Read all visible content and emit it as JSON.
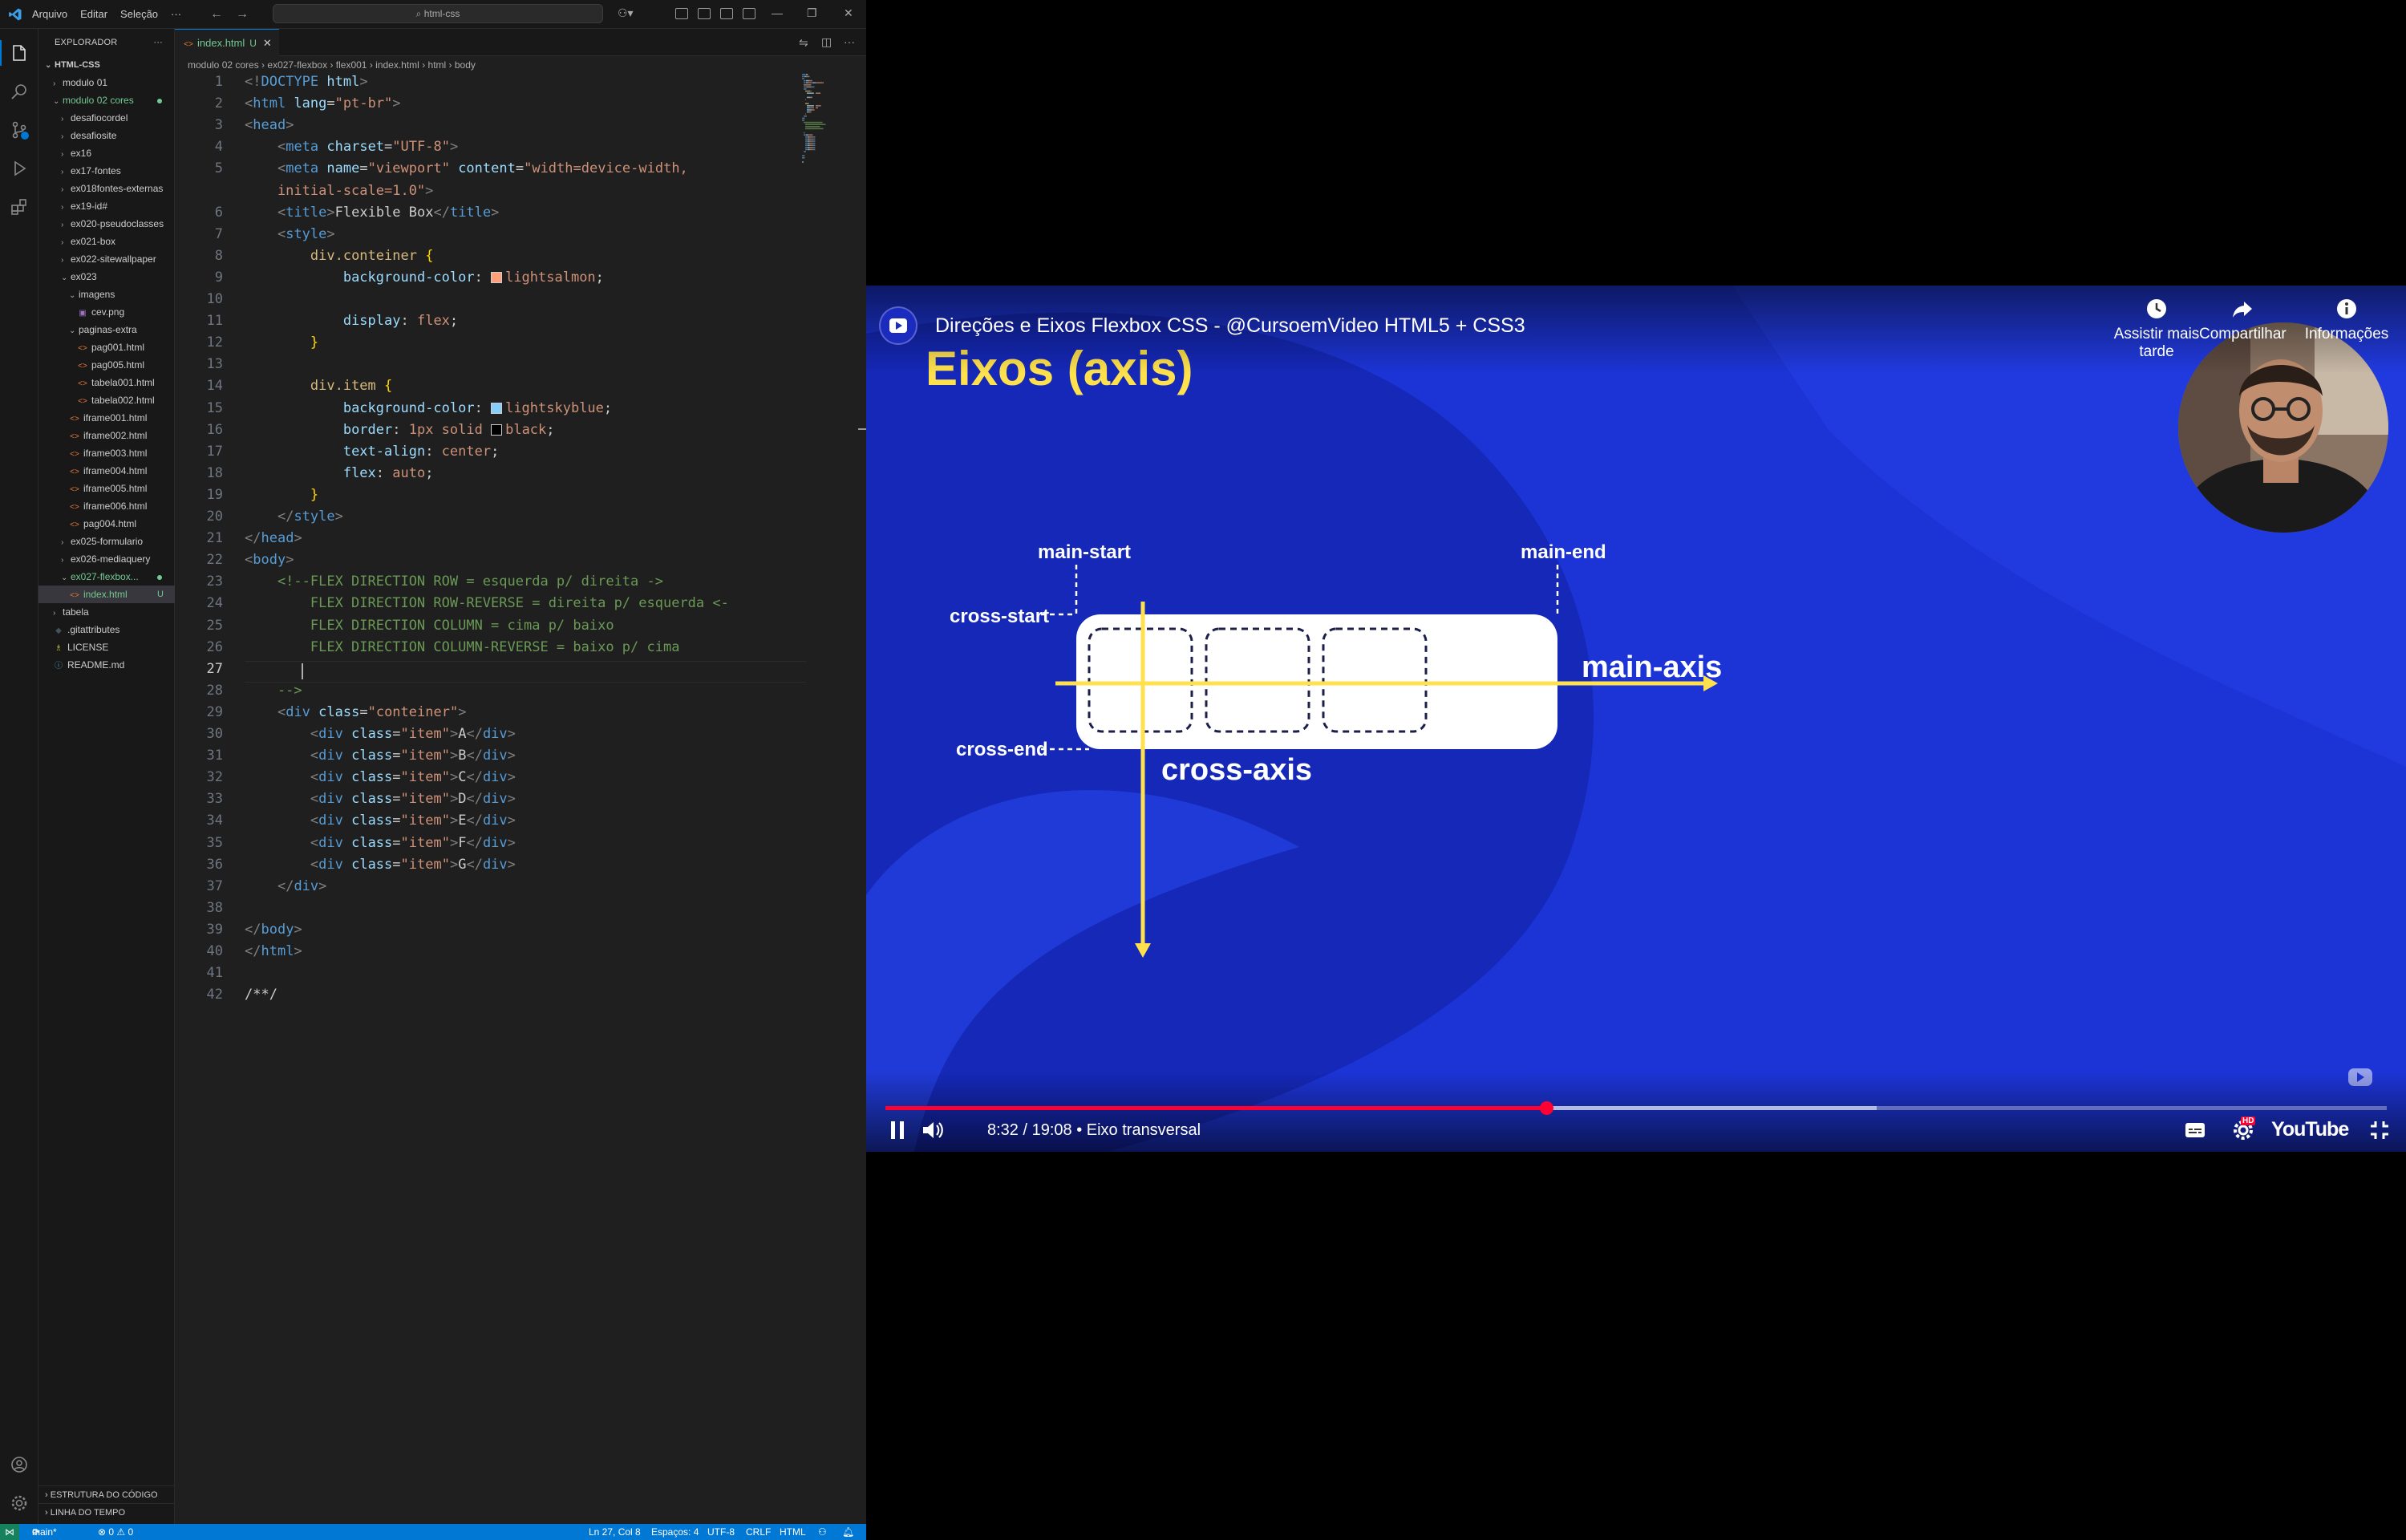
{
  "vscode": {
    "menu": [
      "Arquivo",
      "Editar",
      "Seleção",
      "···"
    ],
    "search_label": "html-css",
    "sidebar_title": "EXPLORADOR",
    "root": "HTML-CSS",
    "tree": [
      {
        "label": "modulo 01",
        "indent": 1,
        "type": "folder",
        "open": false
      },
      {
        "label": "modulo 02 cores",
        "indent": 1,
        "type": "folder",
        "open": true,
        "green": true,
        "dot": true
      },
      {
        "label": "desafiocordel",
        "indent": 2,
        "type": "folder",
        "open": false
      },
      {
        "label": "desafiosite",
        "indent": 2,
        "type": "folder",
        "open": false
      },
      {
        "label": "ex16",
        "indent": 2,
        "type": "folder",
        "open": false
      },
      {
        "label": "ex17-fontes",
        "indent": 2,
        "type": "folder",
        "open": false
      },
      {
        "label": "ex018fontes-externas",
        "indent": 2,
        "type": "folder",
        "open": false
      },
      {
        "label": "ex19-id#",
        "indent": 2,
        "type": "folder",
        "open": false
      },
      {
        "label": "ex020-pseudoclasses",
        "indent": 2,
        "type": "folder",
        "open": false
      },
      {
        "label": "ex021-box",
        "indent": 2,
        "type": "folder",
        "open": false
      },
      {
        "label": "ex022-sitewallpaper",
        "indent": 2,
        "type": "folder",
        "open": false
      },
      {
        "label": "ex023",
        "indent": 2,
        "type": "folder",
        "open": true
      },
      {
        "label": "imagens",
        "indent": 3,
        "type": "folder",
        "open": true
      },
      {
        "label": "cev.png",
        "indent": 4,
        "type": "img"
      },
      {
        "label": "paginas-extra",
        "indent": 3,
        "type": "folder",
        "open": true
      },
      {
        "label": "pag001.html",
        "indent": 4,
        "type": "html"
      },
      {
        "label": "pag005.html",
        "indent": 4,
        "type": "html"
      },
      {
        "label": "tabela001.html",
        "indent": 4,
        "type": "html"
      },
      {
        "label": "tabela002.html",
        "indent": 4,
        "type": "html"
      },
      {
        "label": "iframe001.html",
        "indent": 3,
        "type": "html"
      },
      {
        "label": "iframe002.html",
        "indent": 3,
        "type": "html"
      },
      {
        "label": "iframe003.html",
        "indent": 3,
        "type": "html"
      },
      {
        "label": "iframe004.html",
        "indent": 3,
        "type": "html"
      },
      {
        "label": "iframe005.html",
        "indent": 3,
        "type": "html"
      },
      {
        "label": "iframe006.html",
        "indent": 3,
        "type": "html"
      },
      {
        "label": "pag004.html",
        "indent": 3,
        "type": "html"
      },
      {
        "label": "ex025-formulario",
        "indent": 2,
        "type": "folder",
        "open": false
      },
      {
        "label": "ex026-mediaquery",
        "indent": 2,
        "type": "folder",
        "open": false
      },
      {
        "label": "ex027-flexbox...",
        "indent": 2,
        "type": "folder",
        "open": true,
        "green": true,
        "dot": true,
        "sel": true
      },
      {
        "label": "index.html",
        "indent": 3,
        "type": "html",
        "green": true,
        "badge": "U",
        "sel2": true
      },
      {
        "label": "tabela",
        "indent": 1,
        "type": "folder",
        "open": false
      },
      {
        "label": ".gitattributes",
        "indent": 1,
        "type": "git"
      },
      {
        "label": "LICENSE",
        "indent": 1,
        "type": "lic"
      },
      {
        "label": "README.md",
        "indent": 1,
        "type": "info"
      }
    ],
    "outline": "ESTRUTURA DO CÓDIGO",
    "timeline": "LINHA DO TEMPO",
    "tab_label": "index.html",
    "tab_badge": "U",
    "breadcrumb": [
      "modulo 02 cores",
      "ex027-flexbox",
      "flex001",
      "index.html",
      "html",
      "body"
    ],
    "code_lines": [
      [
        [
          "t",
          "<!"
        ],
        [
          "tg",
          "DOCTYPE"
        ],
        [
          "at",
          " html"
        ],
        [
          "t",
          ">"
        ]
      ],
      [
        [
          "t",
          "<"
        ],
        [
          "tg",
          "html"
        ],
        [
          "at",
          " lang"
        ],
        [
          "c",
          "="
        ],
        [
          "st",
          "\"pt-br\""
        ],
        [
          "t",
          ">"
        ]
      ],
      [
        [
          "t",
          "<"
        ],
        [
          "tg",
          "head"
        ],
        [
          "t",
          ">"
        ]
      ],
      [
        [
          "c",
          "    "
        ],
        [
          "t",
          "<"
        ],
        [
          "tg",
          "meta"
        ],
        [
          "at",
          " charset"
        ],
        [
          "c",
          "="
        ],
        [
          "st",
          "\"UTF-8\""
        ],
        [
          "t",
          ">"
        ]
      ],
      [
        [
          "c",
          "    "
        ],
        [
          "t",
          "<"
        ],
        [
          "tg",
          "meta"
        ],
        [
          "at",
          " name"
        ],
        [
          "c",
          "="
        ],
        [
          "st",
          "\"viewport\""
        ],
        [
          "at",
          " content"
        ],
        [
          "c",
          "="
        ],
        [
          "st",
          "\"width=device-width,"
        ]
      ],
      [
        [
          "st",
          "    initial-scale=1.0\""
        ],
        [
          "t",
          ">"
        ]
      ],
      [
        [
          "c",
          "    "
        ],
        [
          "t",
          "<"
        ],
        [
          "tg",
          "title"
        ],
        [
          "t",
          ">"
        ],
        [
          "c",
          "Flexible Box"
        ],
        [
          "t",
          "</"
        ],
        [
          "tg",
          "title"
        ],
        [
          "t",
          ">"
        ]
      ],
      [
        [
          "c",
          "    "
        ],
        [
          "t",
          "<"
        ],
        [
          "tg",
          "style"
        ],
        [
          "t",
          ">"
        ]
      ],
      [
        [
          "c",
          "        "
        ],
        [
          "sel2",
          "div.conteiner"
        ],
        [
          "c",
          " "
        ],
        [
          "br",
          "{"
        ]
      ],
      [
        [
          "c",
          "            "
        ],
        [
          "pr",
          "background-color"
        ],
        [
          "c",
          ": "
        ],
        [
          "sw",
          "#ffa07a"
        ],
        [
          "vl",
          "lightsalmon"
        ],
        [
          "c",
          ";"
        ]
      ],
      [
        [
          "c",
          ""
        ]
      ],
      [
        [
          "c",
          "            "
        ],
        [
          "pr",
          "display"
        ],
        [
          "c",
          ": "
        ],
        [
          "vl",
          "flex"
        ],
        [
          "c",
          ";"
        ]
      ],
      [
        [
          "c",
          "        "
        ],
        [
          "br",
          "}"
        ]
      ],
      [
        [
          "c",
          ""
        ]
      ],
      [
        [
          "c",
          "        "
        ],
        [
          "sel2",
          "div.item"
        ],
        [
          "c",
          " "
        ],
        [
          "br",
          "{"
        ]
      ],
      [
        [
          "c",
          "            "
        ],
        [
          "pr",
          "background-color"
        ],
        [
          "c",
          ": "
        ],
        [
          "sw",
          "#87cefa"
        ],
        [
          "vl",
          "lightskyblue"
        ],
        [
          "c",
          ";"
        ]
      ],
      [
        [
          "c",
          "            "
        ],
        [
          "pr",
          "border"
        ],
        [
          "c",
          ": "
        ],
        [
          "vl",
          "1px solid "
        ],
        [
          "sw",
          "#000000"
        ],
        [
          "vl",
          "black"
        ],
        [
          "c",
          ";"
        ]
      ],
      [
        [
          "c",
          "            "
        ],
        [
          "pr",
          "text-align"
        ],
        [
          "c",
          ": "
        ],
        [
          "vl",
          "center"
        ],
        [
          "c",
          ";"
        ]
      ],
      [
        [
          "c",
          "            "
        ],
        [
          "pr",
          "flex"
        ],
        [
          "c",
          ": "
        ],
        [
          "vl",
          "auto"
        ],
        [
          "c",
          ";"
        ]
      ],
      [
        [
          "c",
          "        "
        ],
        [
          "br",
          "}"
        ]
      ],
      [
        [
          "c",
          "    "
        ],
        [
          "t",
          "</"
        ],
        [
          "tg",
          "style"
        ],
        [
          "t",
          ">"
        ]
      ],
      [
        [
          "t",
          "</"
        ],
        [
          "tg",
          "head"
        ],
        [
          "t",
          ">"
        ]
      ],
      [
        [
          "t",
          "<"
        ],
        [
          "tg",
          "body"
        ],
        [
          "t",
          ">"
        ]
      ],
      [
        [
          "cm",
          "    <!--FLEX DIRECTION ROW = esquerda p/ direita ->"
        ]
      ],
      [
        [
          "cm",
          "        FLEX DIRECTION ROW-REVERSE = direita p/ esquerda <-"
        ]
      ],
      [
        [
          "cm",
          "        FLEX DIRECTION COLUMN = cima p/ baixo"
        ]
      ],
      [
        [
          "cm",
          "        FLEX DIRECTION COLUMN-REVERSE = baixo p/ cima"
        ]
      ],
      [
        [
          "c",
          ""
        ]
      ],
      [
        [
          "cm",
          "    -->"
        ]
      ],
      [
        [
          "c",
          "    "
        ],
        [
          "t",
          "<"
        ],
        [
          "tg",
          "div"
        ],
        [
          "at",
          " class"
        ],
        [
          "c",
          "="
        ],
        [
          "st",
          "\"conteiner\""
        ],
        [
          "t",
          ">"
        ]
      ],
      [
        [
          "c",
          "        "
        ],
        [
          "t",
          "<"
        ],
        [
          "tg",
          "div"
        ],
        [
          "at",
          " class"
        ],
        [
          "c",
          "="
        ],
        [
          "st",
          "\"item\""
        ],
        [
          "t",
          ">"
        ],
        [
          "c",
          "A"
        ],
        [
          "t",
          "</"
        ],
        [
          "tg",
          "div"
        ],
        [
          "t",
          ">"
        ]
      ],
      [
        [
          "c",
          "        "
        ],
        [
          "t",
          "<"
        ],
        [
          "tg",
          "div"
        ],
        [
          "at",
          " class"
        ],
        [
          "c",
          "="
        ],
        [
          "st",
          "\"item\""
        ],
        [
          "t",
          ">"
        ],
        [
          "c",
          "B"
        ],
        [
          "t",
          "</"
        ],
        [
          "tg",
          "div"
        ],
        [
          "t",
          ">"
        ]
      ],
      [
        [
          "c",
          "        "
        ],
        [
          "t",
          "<"
        ],
        [
          "tg",
          "div"
        ],
        [
          "at",
          " class"
        ],
        [
          "c",
          "="
        ],
        [
          "st",
          "\"item\""
        ],
        [
          "t",
          ">"
        ],
        [
          "c",
          "C"
        ],
        [
          "t",
          "</"
        ],
        [
          "tg",
          "div"
        ],
        [
          "t",
          ">"
        ]
      ],
      [
        [
          "c",
          "        "
        ],
        [
          "t",
          "<"
        ],
        [
          "tg",
          "div"
        ],
        [
          "at",
          " class"
        ],
        [
          "c",
          "="
        ],
        [
          "st",
          "\"item\""
        ],
        [
          "t",
          ">"
        ],
        [
          "c",
          "D"
        ],
        [
          "t",
          "</"
        ],
        [
          "tg",
          "div"
        ],
        [
          "t",
          ">"
        ]
      ],
      [
        [
          "c",
          "        "
        ],
        [
          "t",
          "<"
        ],
        [
          "tg",
          "div"
        ],
        [
          "at",
          " class"
        ],
        [
          "c",
          "="
        ],
        [
          "st",
          "\"item\""
        ],
        [
          "t",
          ">"
        ],
        [
          "c",
          "E"
        ],
        [
          "t",
          "</"
        ],
        [
          "tg",
          "div"
        ],
        [
          "t",
          ">"
        ]
      ],
      [
        [
          "c",
          "        "
        ],
        [
          "t",
          "<"
        ],
        [
          "tg",
          "div"
        ],
        [
          "at",
          " class"
        ],
        [
          "c",
          "="
        ],
        [
          "st",
          "\"item\""
        ],
        [
          "t",
          ">"
        ],
        [
          "c",
          "F"
        ],
        [
          "t",
          "</"
        ],
        [
          "tg",
          "div"
        ],
        [
          "t",
          ">"
        ]
      ],
      [
        [
          "c",
          "        "
        ],
        [
          "t",
          "<"
        ],
        [
          "tg",
          "div"
        ],
        [
          "at",
          " class"
        ],
        [
          "c",
          "="
        ],
        [
          "st",
          "\"item\""
        ],
        [
          "t",
          ">"
        ],
        [
          "c",
          "G"
        ],
        [
          "t",
          "</"
        ],
        [
          "tg",
          "div"
        ],
        [
          "t",
          ">"
        ]
      ],
      [
        [
          "c",
          "    "
        ],
        [
          "t",
          "</"
        ],
        [
          "tg",
          "div"
        ],
        [
          "t",
          ">"
        ]
      ],
      [
        [
          "c",
          ""
        ]
      ],
      [
        [
          "t",
          "</"
        ],
        [
          "tg",
          "body"
        ],
        [
          "t",
          ">"
        ]
      ],
      [
        [
          "t",
          "</"
        ],
        [
          "tg",
          "html"
        ],
        [
          "t",
          ">"
        ]
      ],
      [
        [
          "c",
          ""
        ]
      ],
      [
        [
          "c",
          "/**/"
        ]
      ]
    ],
    "line_numbers": [
      "1",
      "2",
      "3",
      "4",
      "5",
      "",
      "6",
      "7",
      "8",
      "9",
      "10",
      "11",
      "12",
      "13",
      "14",
      "15",
      "16",
      "17",
      "18",
      "19",
      "20",
      "21",
      "22",
      "23",
      "24",
      "25",
      "26",
      "27",
      "28",
      "29",
      "30",
      "31",
      "32",
      "33",
      "34",
      "35",
      "36",
      "37",
      "38",
      "39",
      "40",
      "41",
      "42"
    ],
    "current_line": "27",
    "status": {
      "branch": "main*",
      "problems": "⊗ 0 ⚠ 0",
      "position": "Ln 27, Col 8",
      "spaces": "Espaços: 4",
      "encoding": "UTF-8",
      "eol": "CRLF",
      "language": "HTML"
    }
  },
  "youtube": {
    "title": "Direções e Eixos Flexbox CSS - @CursoemVideo HTML5 + CSS3",
    "watch_later": "Assistir mais tarde",
    "share": "Compartilhar",
    "info": "Informações",
    "time": "8:32 / 19:08 • Eixo transversal",
    "progress": 0.44,
    "buffered": 0.66,
    "brand": "YouTube",
    "hd": "HD",
    "slide": {
      "heading": "Eixos (axis)",
      "main_start": "main-start",
      "main_end": "main-end",
      "cross_start": "cross-start",
      "cross_end": "cross-end",
      "main_axis": "main-axis",
      "cross_axis": "cross-axis"
    },
    "colors": {
      "accent": "#ff0033",
      "slide_bg": "#1c34d6",
      "axis": "#ffe14d"
    }
  }
}
